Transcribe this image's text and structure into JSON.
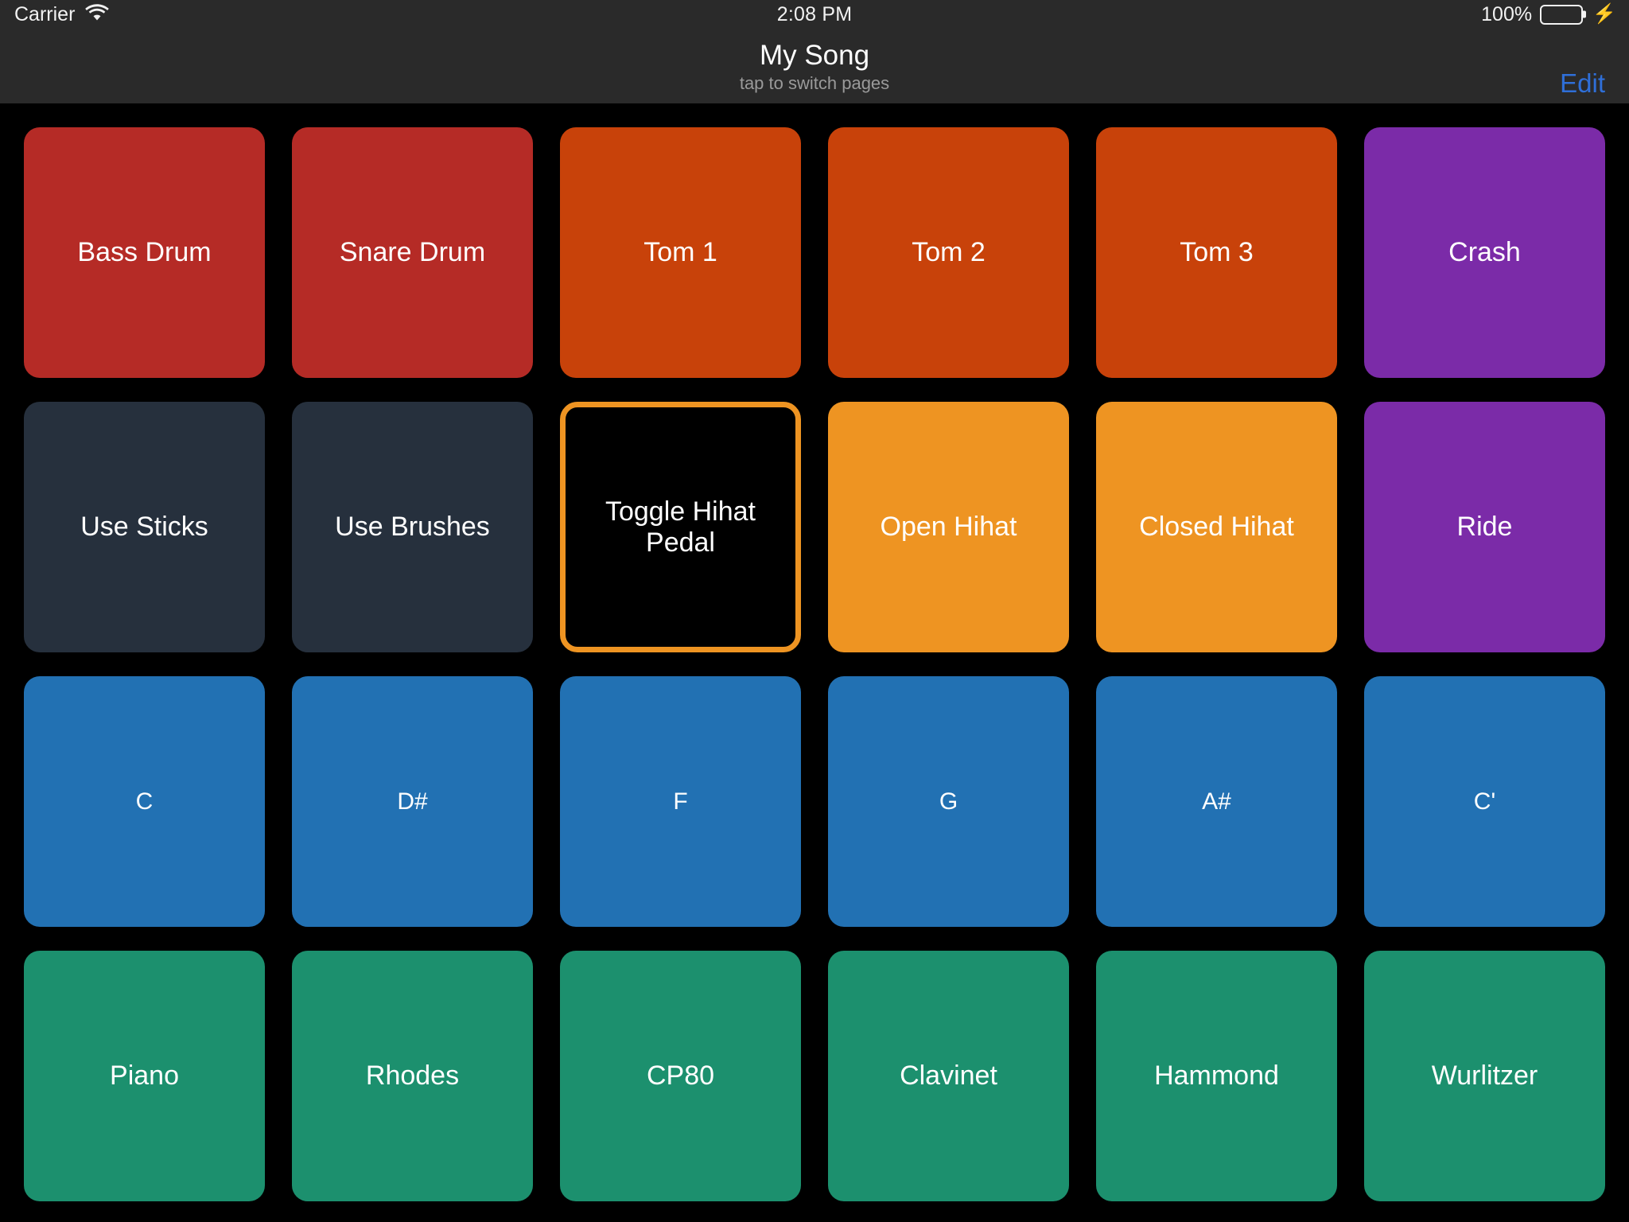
{
  "status_bar": {
    "carrier": "Carrier",
    "wifi_icon": "wifi-icon",
    "time": "2:08 PM",
    "battery_percent": "100%",
    "battery_icon": "battery-icon",
    "charging_icon": "⚡"
  },
  "nav_bar": {
    "title": "My Song",
    "subtitle": "tap to switch pages",
    "edit_label": "Edit"
  },
  "colors": {
    "background": "#000000",
    "chrome": "#2a2a2a",
    "accent_blue": "#2f6fd8",
    "red": "#b52b26",
    "orange_red": "#c8420a",
    "purple": "#7b2ba8",
    "slate": "#26303d",
    "orange": "#ee9422",
    "blue": "#2271b3",
    "green": "#1c906e",
    "selected_fill": "#000000",
    "selected_border": "#ee9422",
    "battery_green": "#4cd964"
  },
  "pads": [
    {
      "label": "Bass Drum",
      "color": "#b52b26",
      "selected": false,
      "small": false
    },
    {
      "label": "Snare Drum",
      "color": "#b52b26",
      "selected": false,
      "small": false
    },
    {
      "label": "Tom 1",
      "color": "#c8420a",
      "selected": false,
      "small": false
    },
    {
      "label": "Tom 2",
      "color": "#c8420a",
      "selected": false,
      "small": false
    },
    {
      "label": "Tom 3",
      "color": "#c8420a",
      "selected": false,
      "small": false
    },
    {
      "label": "Crash",
      "color": "#7b2ba8",
      "selected": false,
      "small": false
    },
    {
      "label": "Use Sticks",
      "color": "#26303d",
      "selected": false,
      "small": false
    },
    {
      "label": "Use Brushes",
      "color": "#26303d",
      "selected": false,
      "small": false
    },
    {
      "label": "Toggle Hihat Pedal",
      "color": "#000000",
      "selected": true,
      "small": false
    },
    {
      "label": "Open Hihat",
      "color": "#ee9422",
      "selected": false,
      "small": false
    },
    {
      "label": "Closed Hihat",
      "color": "#ee9422",
      "selected": false,
      "small": false
    },
    {
      "label": "Ride",
      "color": "#7b2ba8",
      "selected": false,
      "small": false
    },
    {
      "label": "C",
      "color": "#2271b3",
      "selected": false,
      "small": true
    },
    {
      "label": "D#",
      "color": "#2271b3",
      "selected": false,
      "small": true
    },
    {
      "label": "F",
      "color": "#2271b3",
      "selected": false,
      "small": true
    },
    {
      "label": "G",
      "color": "#2271b3",
      "selected": false,
      "small": true
    },
    {
      "label": "A#",
      "color": "#2271b3",
      "selected": false,
      "small": true
    },
    {
      "label": "C'",
      "color": "#2271b3",
      "selected": false,
      "small": true
    },
    {
      "label": "Piano",
      "color": "#1c906e",
      "selected": false,
      "small": false
    },
    {
      "label": "Rhodes",
      "color": "#1c906e",
      "selected": false,
      "small": false
    },
    {
      "label": "CP80",
      "color": "#1c906e",
      "selected": false,
      "small": false
    },
    {
      "label": "Clavinet",
      "color": "#1c906e",
      "selected": false,
      "small": false
    },
    {
      "label": "Hammond",
      "color": "#1c906e",
      "selected": false,
      "small": false
    },
    {
      "label": "Wurlitzer",
      "color": "#1c906e",
      "selected": false,
      "small": false
    }
  ]
}
